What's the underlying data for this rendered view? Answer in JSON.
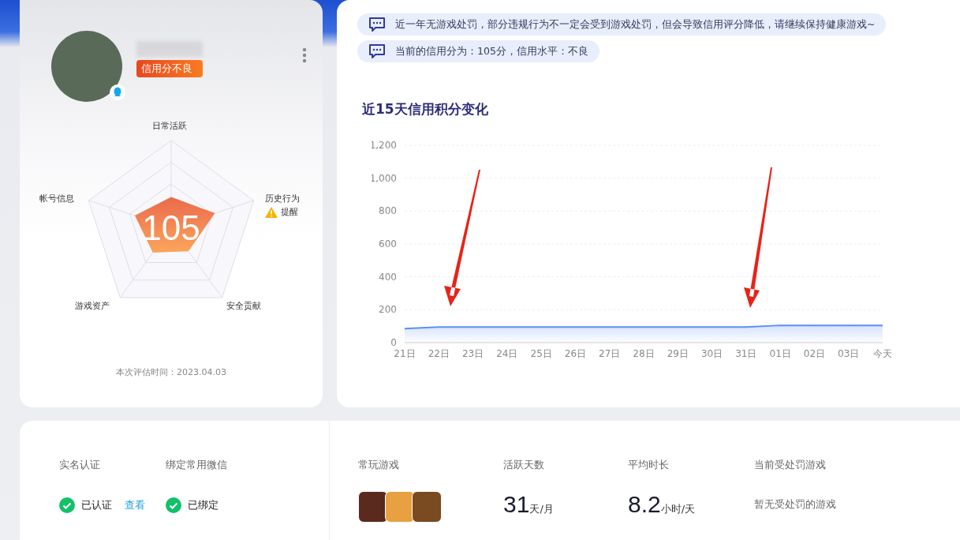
{
  "profile": {
    "badge": "信用分不良",
    "score": "105",
    "axes": [
      "日常活跃",
      "历史行为",
      "安全贡献",
      "游戏资产",
      "帐号信息"
    ],
    "warning": "提醒",
    "eval_time": "本次评估时间：2023.04.03"
  },
  "notices": [
    "近一年无游戏处罚，部分违规行为不一定会受到游戏处罚，但会导致信用评分降低，请继续保持健康游戏~",
    "当前的信用分为：105分，信用水平：不良"
  ],
  "chart_title": "近15天信用积分变化",
  "chart_data": {
    "type": "area",
    "categories": [
      "21日",
      "22日",
      "23日",
      "24日",
      "25日",
      "26日",
      "27日",
      "28日",
      "29日",
      "30日",
      "31日",
      "01日",
      "02日",
      "03日",
      "今天"
    ],
    "grid": true,
    "series": [
      {
        "color": "#5b8ff9",
        "values": [
          85,
          95,
          95,
          95,
          95,
          95,
          95,
          95,
          95,
          95,
          95,
          105,
          105,
          105,
          105
        ]
      }
    ],
    "ylim": [
      0,
      1200
    ],
    "yticks": [
      {
        "value": 0,
        "label": "0"
      },
      {
        "value": 200,
        "label": "200"
      },
      {
        "value": 400,
        "label": "400"
      },
      {
        "value": 600,
        "label": "600"
      },
      {
        "value": 800,
        "label": "800"
      },
      {
        "value": 1000,
        "label": "1,000"
      },
      {
        "value": 1200,
        "label": "1,200"
      }
    ]
  },
  "account": [
    {
      "label": "实名认证",
      "status": "已认证",
      "link": "查看"
    },
    {
      "label": "绑定常用微信",
      "status": "已绑定"
    }
  ],
  "stats": [
    {
      "kind": "games",
      "label": "常玩游戏"
    },
    {
      "kind": "number",
      "label": "活跃天数",
      "value": "31",
      "unit": "天/月"
    },
    {
      "kind": "number",
      "label": "平均时长",
      "value": "8.2",
      "unit": "小时/天"
    },
    {
      "kind": "text",
      "label": "当前受处罚游戏",
      "value": "暂无受处罚的游戏"
    }
  ]
}
